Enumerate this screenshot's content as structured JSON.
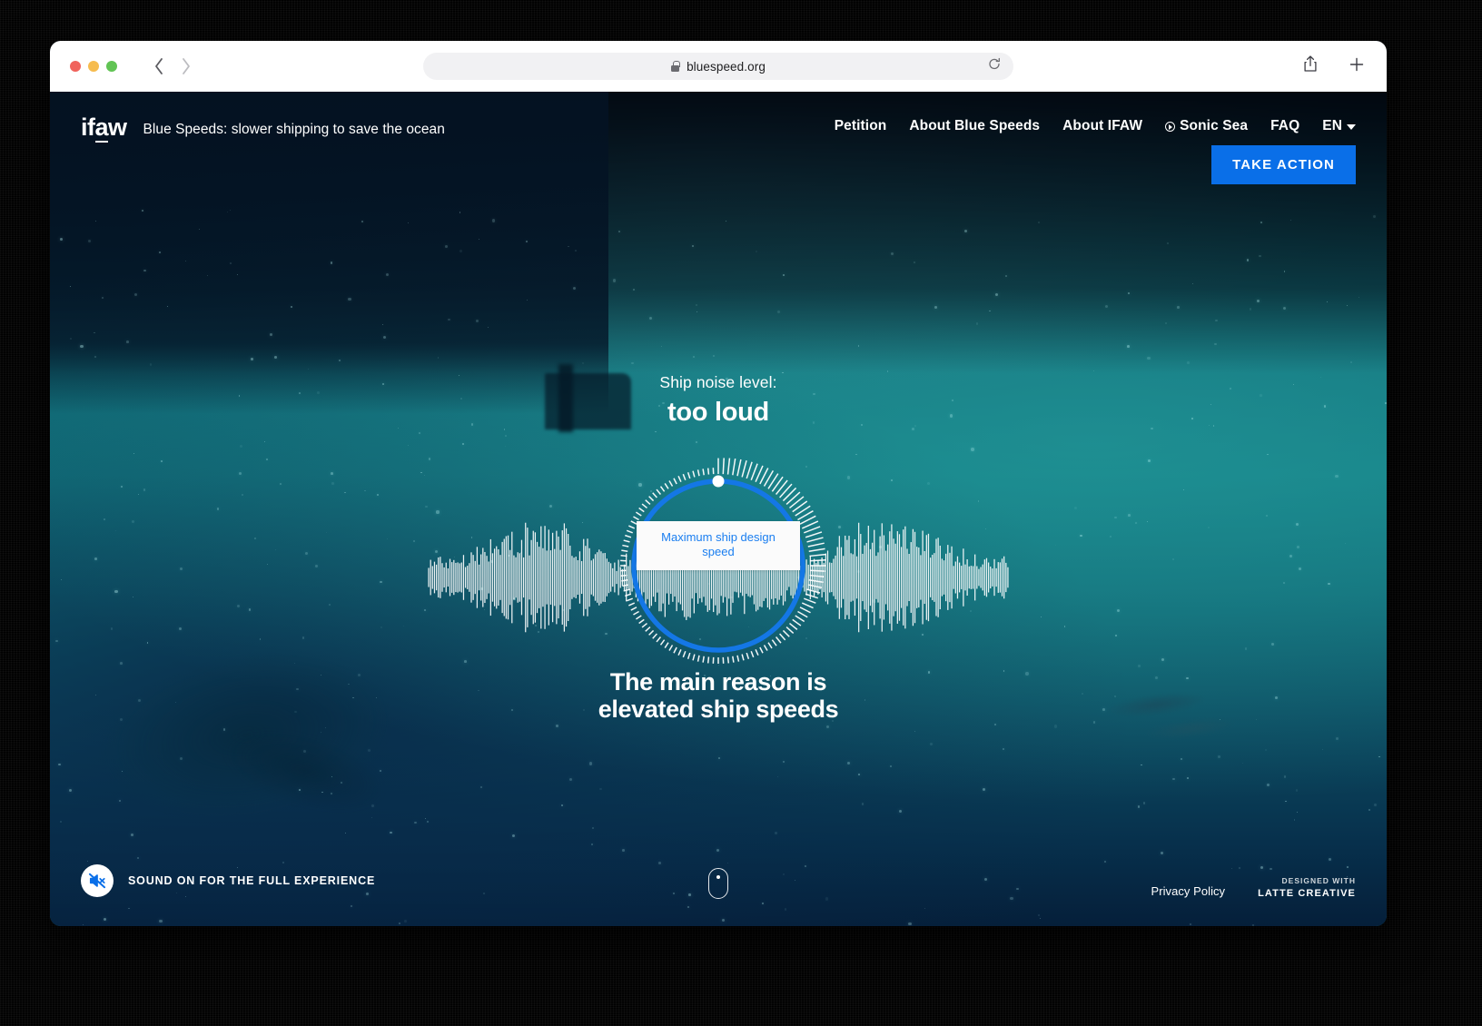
{
  "browser": {
    "url": "bluespeed.org",
    "lock_icon": "lock-icon",
    "reload_icon": "reload-icon",
    "back_icon": "chevron-left-icon",
    "forward_icon": "chevron-right-icon",
    "share_icon": "share-icon",
    "newtab_icon": "plus-icon"
  },
  "site": {
    "logo": "ifaw",
    "logo_plain_1": "if",
    "logo_underlined": "a",
    "logo_plain_2": "w",
    "tagline": "Blue Speeds: slower shipping to save the ocean"
  },
  "nav": {
    "items": [
      {
        "label": "Petition",
        "icon": null
      },
      {
        "label": "About Blue Speeds",
        "icon": null
      },
      {
        "label": "About IFAW",
        "icon": null
      },
      {
        "label": "Sonic Sea",
        "icon": "play-circle-icon"
      },
      {
        "label": "FAQ",
        "icon": null
      }
    ],
    "language": "EN",
    "language_caret": "chevron-down-icon",
    "cta_label": "TAKE ACTION",
    "cta_color": "#0a6fe8"
  },
  "hero": {
    "noise_label": "Ship noise level:",
    "noise_value": "too loud",
    "dial_tooltip": "Maximum ship design speed",
    "dial_accent_color": "#1477e6",
    "headline_line1": "The main reason is",
    "headline_line2": "elevated ship speeds"
  },
  "footer": {
    "sound_icon": "speaker-muted-icon",
    "sound_label": "SOUND ON FOR THE FULL EXPERIENCE",
    "scroll_icon": "scroll-mouse-icon",
    "privacy_label": "Privacy Policy",
    "credit_small": "DESIGNED WITH",
    "credit_big": "LATTE CREATIVE"
  }
}
